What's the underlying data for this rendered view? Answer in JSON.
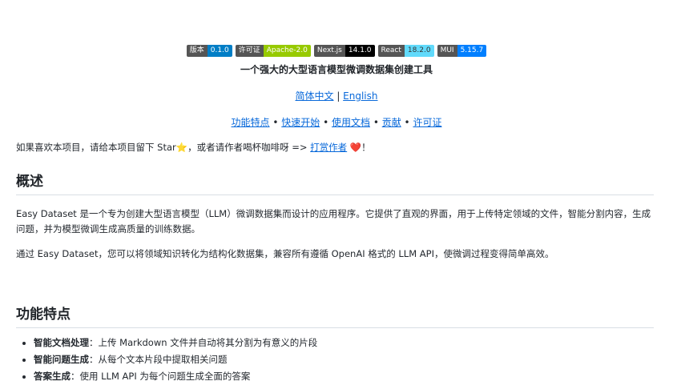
{
  "badges": [
    {
      "label": "版本",
      "value": "0.1.0",
      "color": "#007ec6"
    },
    {
      "label": "许可证",
      "value": "Apache-2.0",
      "color": "#97ca00"
    },
    {
      "label": "Next.js",
      "value": "14.1.0",
      "color": "#000000"
    },
    {
      "label": "React",
      "value": "18.2.0",
      "color": "#61dafb"
    },
    {
      "label": "MUI",
      "value": "5.15.7",
      "color": "#007fff"
    }
  ],
  "title": "一个强大的大型语言模型微调数据集创建工具",
  "langs": {
    "zh": "简体中文",
    "sep": " | ",
    "en": "English"
  },
  "nav": {
    "features": "功能特点",
    "quickstart": "快速开始",
    "docs": "使用文档",
    "contrib": "贡献",
    "license": "许可证",
    "sep": " • "
  },
  "starline": {
    "text1": "如果喜欢本项目，请给本项目留下 Star",
    "text2": "，或者请作者喝杯咖啡呀 => ",
    "link": "打赏作者",
    "text3": "！",
    "star_icon": "⭐",
    "heart_icon": "❤️"
  },
  "overview": {
    "heading": "概述",
    "p1": "Easy Dataset 是一个专为创建大型语言模型（LLM）微调数据集而设计的应用程序。它提供了直观的界面，用于上传特定领域的文件，智能分割内容，生成问题，并为模型微调生成高质量的训练数据。",
    "p2": "通过 Easy Dataset，您可以将领域知识转化为结构化数据集，兼容所有遵循 OpenAI 格式的 LLM API，使微调过程变得简单高效。"
  },
  "features": {
    "heading": "功能特点",
    "items": [
      {
        "bold": "智能文档处理",
        "text": "：上传 Markdown 文件并自动将其分割为有意义的片段"
      },
      {
        "bold": "智能问题生成",
        "text": "：从每个文本片段中提取相关问题"
      },
      {
        "bold": "答案生成",
        "text": "：使用 LLM API 为每个问题生成全面的答案"
      }
    ]
  }
}
